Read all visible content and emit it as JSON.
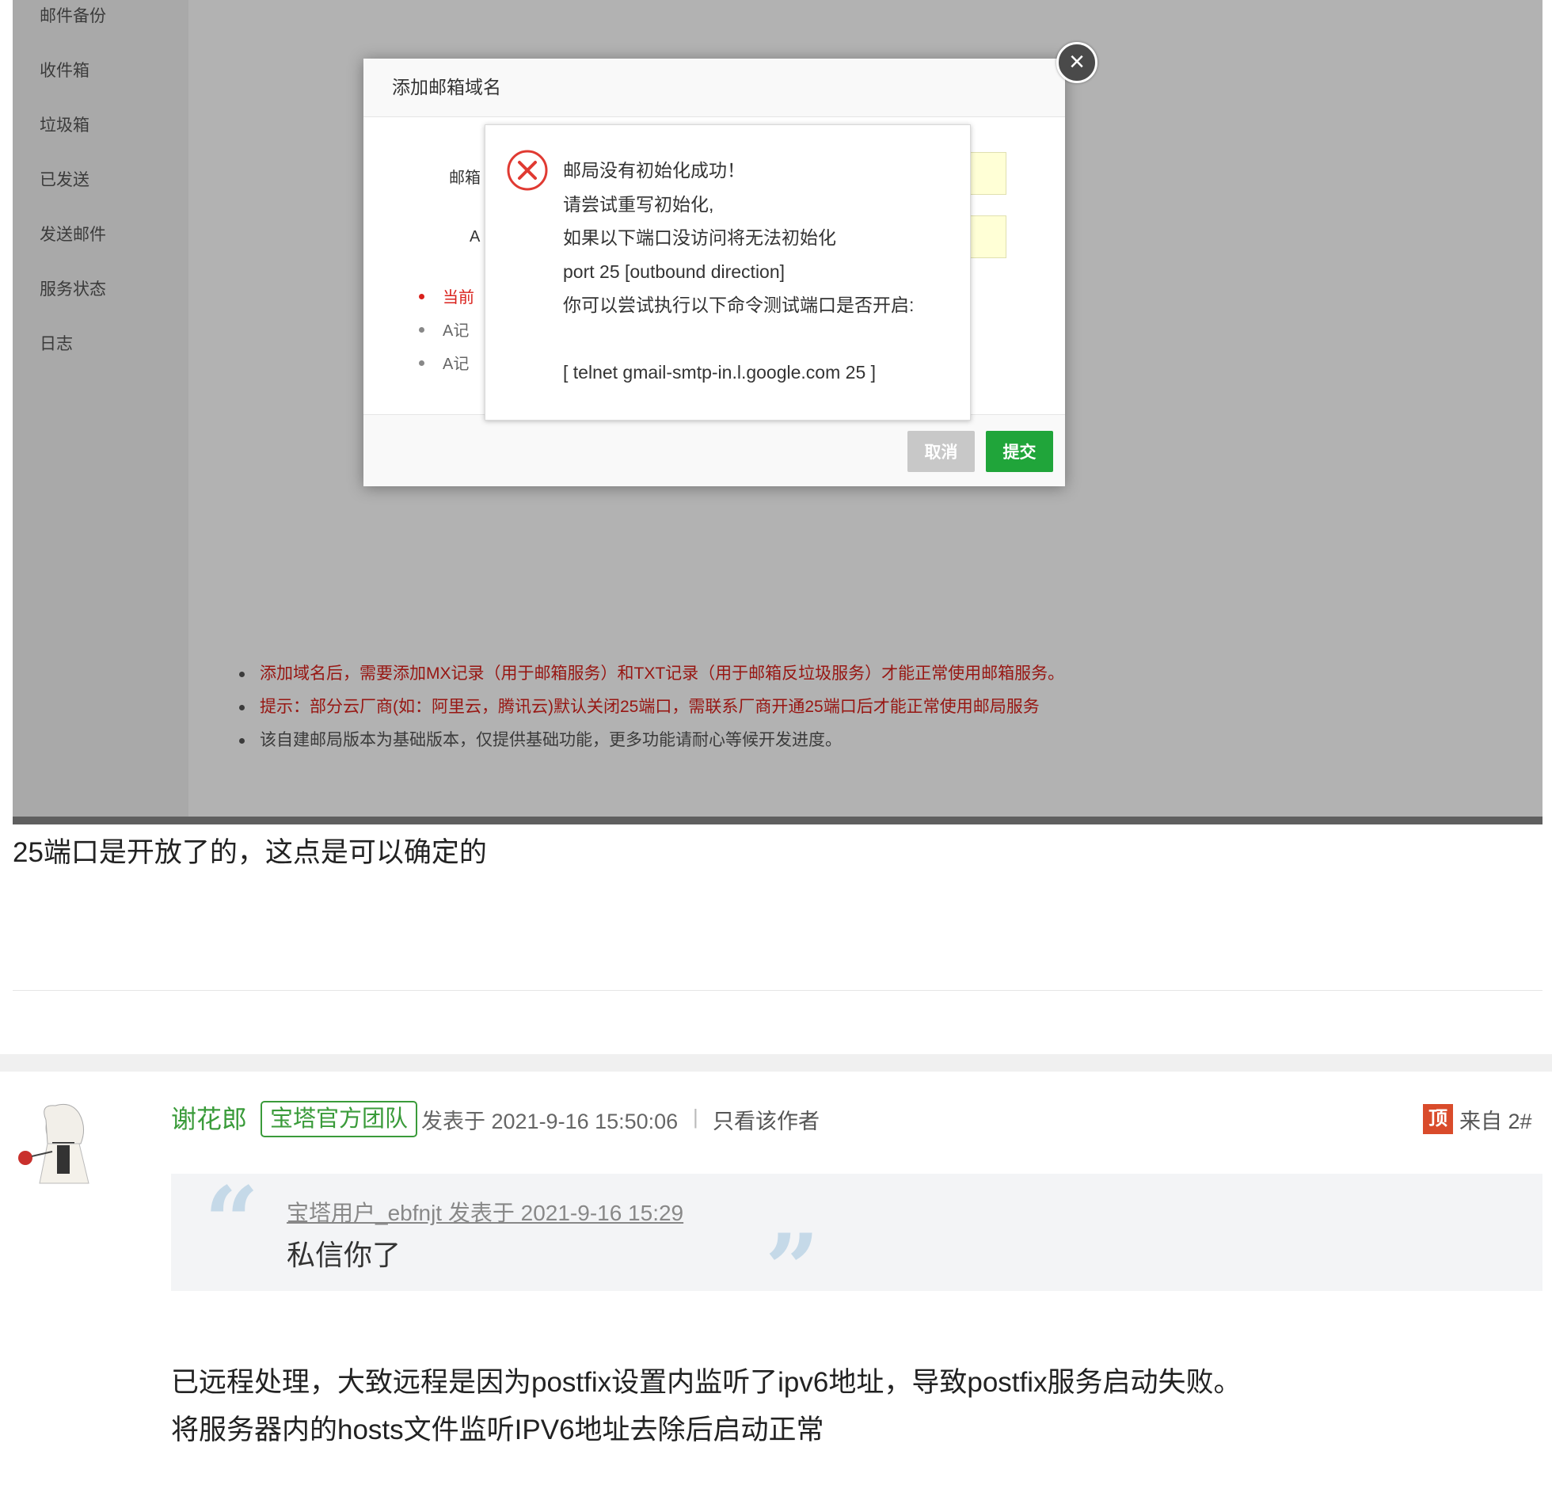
{
  "screenshot": {
    "sidebar_items": [
      "邮件备份",
      "收件箱",
      "垃圾箱",
      "已发送",
      "发送邮件",
      "服务状态",
      "日志"
    ],
    "modal": {
      "title": "添加邮箱域名",
      "field_label_1": "邮箱",
      "field_label_2": "A",
      "list_1": "当前",
      "list_2": "A记",
      "list_3": "A记",
      "close_glyph": "×",
      "cancel_label": "取消",
      "submit_label": "提交"
    },
    "error_popup": {
      "lines": [
        "邮局没有初始化成功！",
        "请尝试重写初始化,",
        "如果以下端口没访问将无法初始化",
        "port 25 [outbound direction]",
        "你可以尝试执行以下命令测试端口是否开启:",
        "",
        "[ telnet gmail-smtp-in.l.google.com 25 ]"
      ]
    },
    "background_notes": [
      "添加域名后，需要添加MX记录（用于邮箱服务）和TXT记录（用于邮箱反垃圾服务）才能正常使用邮箱服务。",
      "提示：部分云厂商(如：阿里云，腾讯云)默认关闭25端口，需联系厂商开通25端口后才能正常使用邮局服务",
      "该自建邮局版本为基础版本，仅提供基础功能，更多功能请耐心等候开发进度。"
    ]
  },
  "caption": "25端口是开放了的，这点是可以确定的",
  "post": {
    "author": "谢花郎",
    "badge": "宝塔官方团队",
    "posted": "发表于 2021-9-16 15:50:06",
    "separator": "|",
    "only_author": "只看该作者",
    "top_badge": "顶",
    "floor": "来自 2#",
    "quote": {
      "source": "宝塔用户_ebfnjt 发表于 2021-9-16 15:29",
      "text": "私信你了",
      "open_mark": "“",
      "close_mark": "”"
    },
    "reply_lines": [
      "已远程处理，大致远程是因为postfix设置内监听了ipv6地址，导致postfix服务启动失败。",
      "将服务器内的hosts文件监听IPV6地址去除后启动正常"
    ]
  },
  "colors": {
    "brand_green": "#20a53a",
    "author_green": "#3a9b3a",
    "error_red": "#e03a32",
    "note_red": "#d9211c"
  }
}
